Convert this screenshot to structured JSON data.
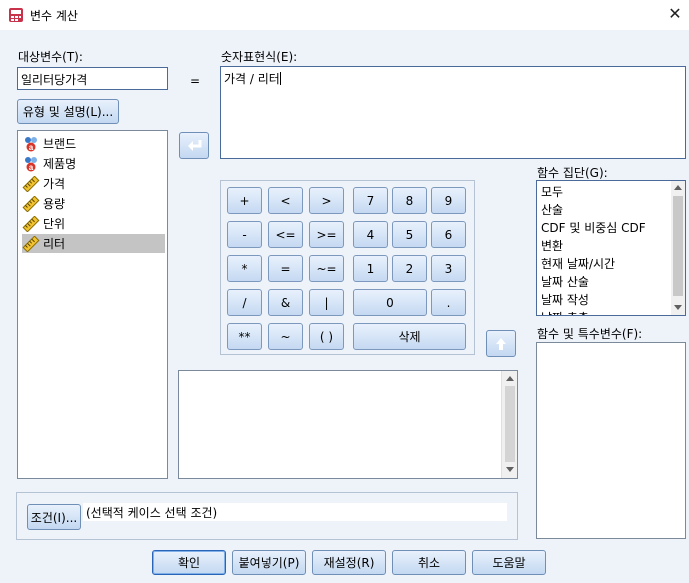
{
  "window": {
    "title": "변수 계산",
    "close_glyph": "✕"
  },
  "target": {
    "label": "대상변수(T):",
    "value": "일리터당가격",
    "type_label_button": "유형 및 설명(L)..."
  },
  "equals_sign": "=",
  "expression": {
    "label": "숫자표현식(E):",
    "value": "가격 / 리터"
  },
  "variables": [
    {
      "name": "브랜드",
      "icon": "nominal-icon",
      "selected": false
    },
    {
      "name": "제품명",
      "icon": "nominal-icon",
      "selected": false
    },
    {
      "name": "가격",
      "icon": "scale-ruler-icon",
      "selected": false
    },
    {
      "name": "용량",
      "icon": "scale-ruler-icon",
      "selected": false
    },
    {
      "name": "단위",
      "icon": "scale-ruler-icon",
      "selected": false
    },
    {
      "name": "리터",
      "icon": "scale-ruler-icon",
      "selected": true
    }
  ],
  "calculator": {
    "row1": [
      "+",
      "<",
      ">",
      "7",
      "8",
      "9"
    ],
    "row2": [
      "-",
      "<=",
      ">=",
      "4",
      "5",
      "6"
    ],
    "row3": [
      "*",
      "=",
      "~=",
      "1",
      "2",
      "3"
    ],
    "row4": [
      "/",
      "&",
      "|",
      "0",
      "."
    ],
    "row5": [
      "**",
      "~",
      "( )",
      "삭제"
    ]
  },
  "function_group": {
    "label": "함수 집단(G):",
    "items": [
      "모두",
      "산술",
      "CDF 및 비중심 CDF",
      "변환",
      "현재 날짜/시간",
      "날짜 산술",
      "날짜 작성",
      "날짜 추출"
    ]
  },
  "functions": {
    "label": "함수 및 특수변수(F):"
  },
  "condition": {
    "button": "조건(I)...",
    "text": "(선택적 케이스 선택 조건)"
  },
  "buttons": {
    "ok": "확인",
    "paste": "붙여넣기(P)",
    "reset": "재설정(R)",
    "cancel": "취소",
    "help": "도움말"
  }
}
